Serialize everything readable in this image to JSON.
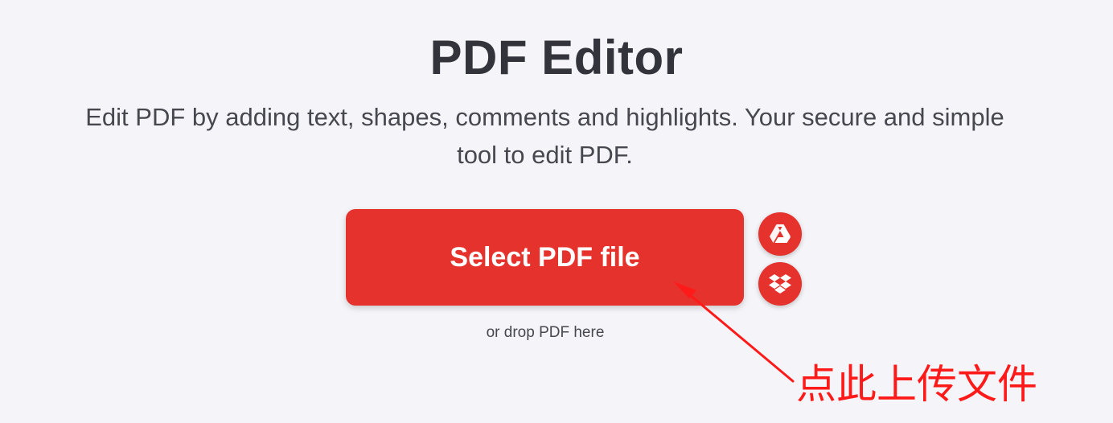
{
  "header": {
    "title": "PDF Editor",
    "subtitle": "Edit PDF by adding text, shapes, comments and highlights. Your secure and simple tool to edit PDF."
  },
  "upload": {
    "select_label": "Select PDF file",
    "drop_hint": "or drop PDF here",
    "cloud_buttons": [
      {
        "icon": "google-drive-icon"
      },
      {
        "icon": "dropbox-icon"
      }
    ]
  },
  "annotation": {
    "text": "点此上传文件",
    "color": "#ff1a1a"
  },
  "colors": {
    "accent": "#e5322d",
    "background": "#f5f5f9",
    "text": "#33333b"
  }
}
